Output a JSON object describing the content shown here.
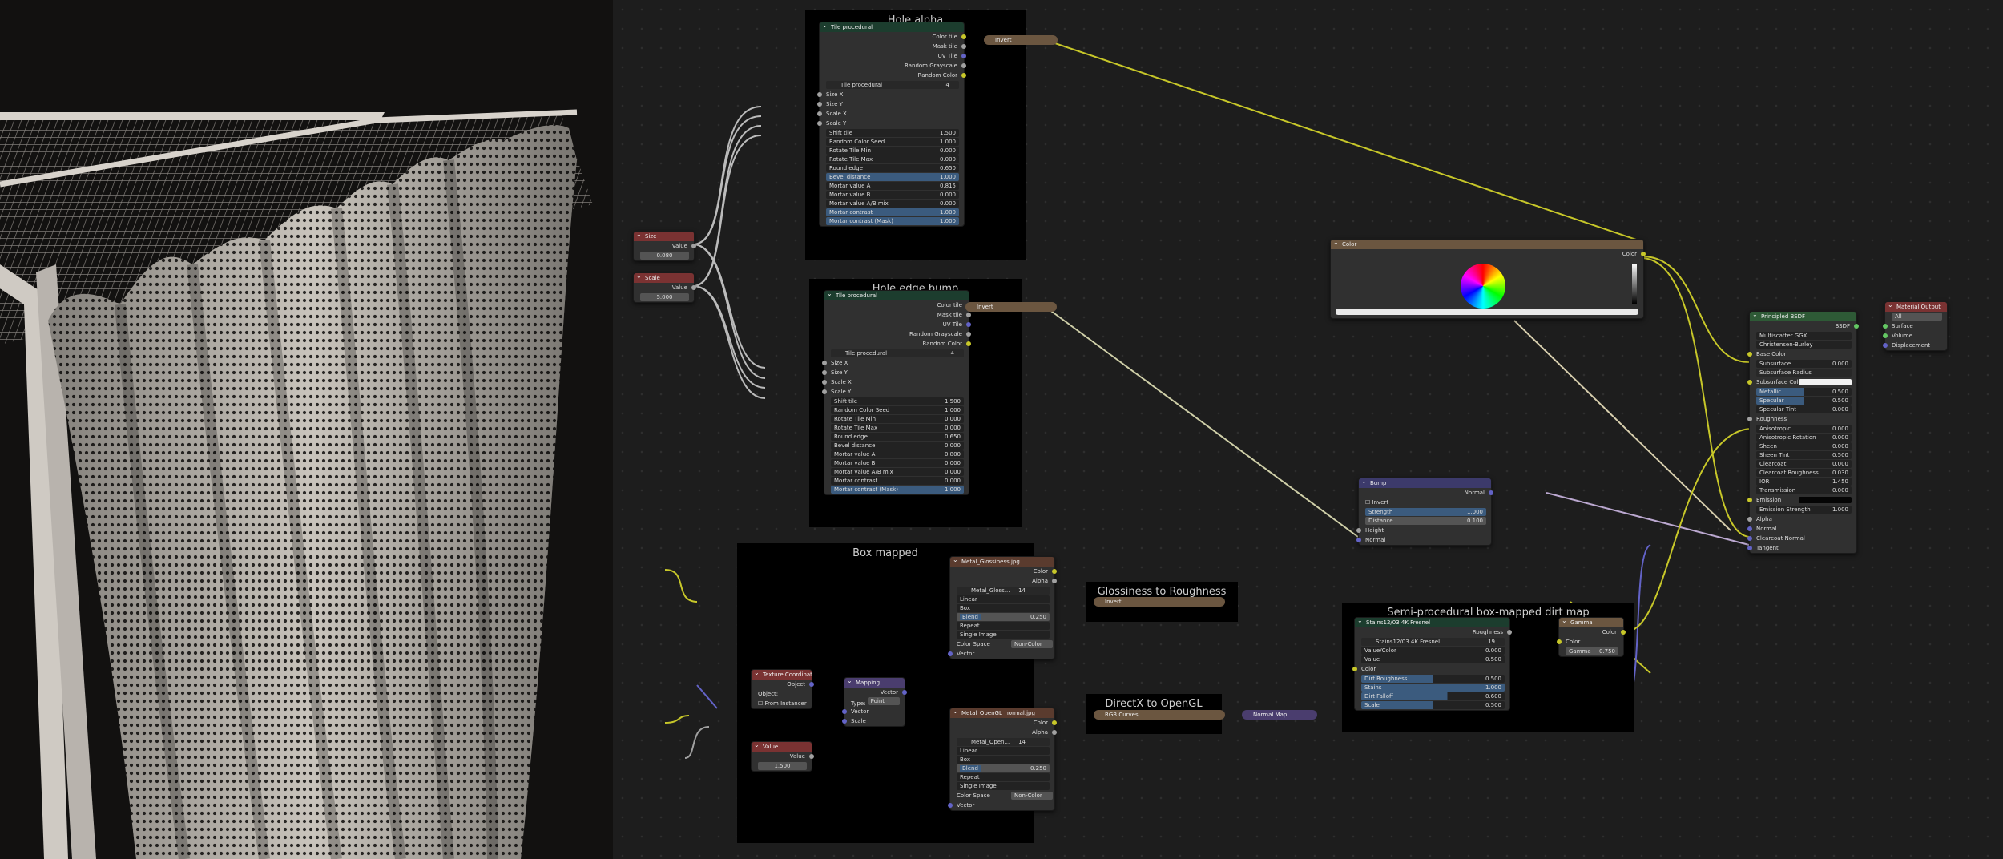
{
  "frames": {
    "hole_alpha": "Hole alpha",
    "hole_edge_bump": "Hole edge bump",
    "box_mapped": "Box mapped",
    "gloss_to_rough": "Glossiness to Roughness",
    "directx_to_opengl": "DirectX to OpenGL",
    "dirt_map": "Semi-procedural box-mapped dirt map"
  },
  "tile_alpha": {
    "title": "Tile procedural",
    "outputs": [
      "Color tile",
      "Mask tile",
      "UV Tile",
      "Random Grayscale",
      "Random Color"
    ],
    "group_name": "Tile procedural",
    "group_users": "4",
    "inputs": [
      "Size X",
      "Size Y",
      "Scale X",
      "Scale Y"
    ],
    "fields": [
      {
        "label": "Shift tile",
        "value": "1.500"
      },
      {
        "label": "Random Color Seed",
        "value": "1.000"
      },
      {
        "label": "Rotate Tile Min",
        "value": "0.000"
      },
      {
        "label": "Rotate Tile Max",
        "value": "0.000"
      },
      {
        "label": "Round edge",
        "value": "0.650"
      },
      {
        "label": "Bevel distance",
        "value": "1.000"
      },
      {
        "label": "Mortar value A",
        "value": "0.815"
      },
      {
        "label": "Mortar value B",
        "value": "0.000"
      },
      {
        "label": "Mortar value A/B mix",
        "value": "0.000"
      },
      {
        "label": "Mortar contrast",
        "value": "1.000"
      },
      {
        "label": "Mortar contrast (Mask)",
        "value": "1.000"
      }
    ]
  },
  "tile_bump": {
    "title": "Tile procedural",
    "outputs": [
      "Color tile",
      "Mask tile",
      "UV Tile",
      "Random Grayscale",
      "Random Color"
    ],
    "group_name": "Tile procedural",
    "group_users": "4",
    "inputs": [
      "Size X",
      "Size Y",
      "Scale X",
      "Scale Y"
    ],
    "fields": [
      {
        "label": "Shift tile",
        "value": "1.500"
      },
      {
        "label": "Random Color Seed",
        "value": "1.000"
      },
      {
        "label": "Rotate Tile Min",
        "value": "0.000"
      },
      {
        "label": "Rotate Tile Max",
        "value": "0.000"
      },
      {
        "label": "Round edge",
        "value": "0.650"
      },
      {
        "label": "Bevel distance",
        "value": "0.000"
      },
      {
        "label": "Mortar value A",
        "value": "0.800"
      },
      {
        "label": "Mortar value B",
        "value": "0.000"
      },
      {
        "label": "Mortar value A/B mix",
        "value": "0.000"
      },
      {
        "label": "Mortar contrast",
        "value": "0.000"
      },
      {
        "label": "Mortar contrast (Mask)",
        "value": "1.000"
      }
    ]
  },
  "size_node": {
    "title": "Size",
    "output": "Value",
    "value": "0.080"
  },
  "scale_node": {
    "title": "Scale",
    "output": "Value",
    "value": "5.000"
  },
  "invert_label": "Invert",
  "rgb_curves_label": "RGB Curves",
  "normal_map_label": "Normal Map",
  "tex_gloss": {
    "title": "Metal_Glossiness.jpg",
    "outputs": [
      "Color",
      "Alpha"
    ],
    "image": "Metal_Gloss...",
    "users": "14",
    "interpolation": "Linear",
    "projection": "Box",
    "blend_label": "Blend",
    "blend": "0.250",
    "extension": "Repeat",
    "source": "Single Image",
    "colorspace_label": "Color Space",
    "colorspace": "Non-Color",
    "vector": "Vector"
  },
  "tex_normal": {
    "title": "Metal_OpenGL_normal.jpg",
    "outputs": [
      "Color",
      "Alpha"
    ],
    "image": "Metal_Open...",
    "users": "14",
    "interpolation": "Linear",
    "projection": "Box",
    "blend_label": "Blend",
    "blend": "0.250",
    "extension": "Repeat",
    "source": "Single Image",
    "colorspace_label": "Color Space",
    "colorspace": "Non-Color",
    "vector": "Vector"
  },
  "texcoord": {
    "title": "Texture Coordinate",
    "output": "Object",
    "object_label": "Object:",
    "from_instancer": "From Instancer"
  },
  "mapping": {
    "title": "Mapping",
    "output": "Vector",
    "type_label": "Type:",
    "type": "Point",
    "inputs": [
      "Vector",
      "Scale"
    ]
  },
  "value_node": {
    "title": "Value",
    "output": "Value",
    "value": "1.500"
  },
  "color_node": {
    "title": "Color",
    "output": "Color"
  },
  "bump": {
    "title": "Bump",
    "output": "Normal",
    "invert": "Invert",
    "strength_label": "Strength",
    "strength": "1.000",
    "distance_label": "Distance",
    "distance": "0.100",
    "inputs": [
      "Height",
      "Normal"
    ]
  },
  "dirt": {
    "title": "Stains12/03 4K Fresnel",
    "output": "Roughness",
    "group_name": "Stains12/03 4K Fresnel",
    "group_users": "19",
    "vc_label": "Value/Color",
    "vc": "0.000",
    "value_label": "Value",
    "value": "0.500",
    "color_label": "Color",
    "fields": [
      {
        "label": "Dirt Roughness",
        "value": "0.500"
      },
      {
        "label": "Stains",
        "value": "1.000"
      },
      {
        "label": "Dirt Falloff",
        "value": "0.600"
      },
      {
        "label": "Scale",
        "value": "0.500"
      }
    ]
  },
  "gamma": {
    "title": "Gamma",
    "output": "Color",
    "input": "Color",
    "gamma_label": "Gamma",
    "gamma": "0.750"
  },
  "bsdf": {
    "title": "Principled BSDF",
    "output": "BSDF",
    "distribution": "Multiscatter GGX",
    "subsurface_method": "Christensen-Burley",
    "base_color": "Base Color",
    "subsurface_radius": "Subsurface Radius",
    "subsurface_color": "Subsurface Color",
    "roughness": "Roughness",
    "emission": "Emission",
    "fields": [
      {
        "label": "Subsurface",
        "value": "0.000",
        "style": "dark"
      },
      {
        "label": "Metallic",
        "value": "0.500",
        "style": "blue"
      },
      {
        "label": "Specular",
        "value": "0.500",
        "style": "blue"
      },
      {
        "label": "Specular Tint",
        "value": "0.000",
        "style": "dark"
      }
    ],
    "fields2": [
      {
        "label": "Anisotropic",
        "value": "0.000"
      },
      {
        "label": "Anisotropic Rotation",
        "value": "0.000"
      },
      {
        "label": "Sheen",
        "value": "0.000"
      },
      {
        "label": "Sheen Tint",
        "value": "0.500"
      },
      {
        "label": "Clearcoat",
        "value": "0.000"
      },
      {
        "label": "Clearcoat Roughness",
        "value": "0.030"
      },
      {
        "label": "IOR",
        "value": "1.450"
      },
      {
        "label": "Transmission",
        "value": "0.000"
      }
    ],
    "emission_strength_label": "Emission Strength",
    "emission_strength": "1.000",
    "tail": [
      "Alpha",
      "Normal",
      "Clearcoat Normal",
      "Tangent"
    ]
  },
  "output": {
    "title": "Material Output",
    "target": "All",
    "inputs": [
      "Surface",
      "Volume",
      "Displacement"
    ]
  },
  "colors": {
    "viewport_bg": "#121110",
    "editor_bg": "#1d1d1d",
    "socket_color": "#c7c729",
    "socket_float": "#a1a1a1",
    "socket_vector": "#6363c7",
    "socket_shader": "#63c763"
  }
}
